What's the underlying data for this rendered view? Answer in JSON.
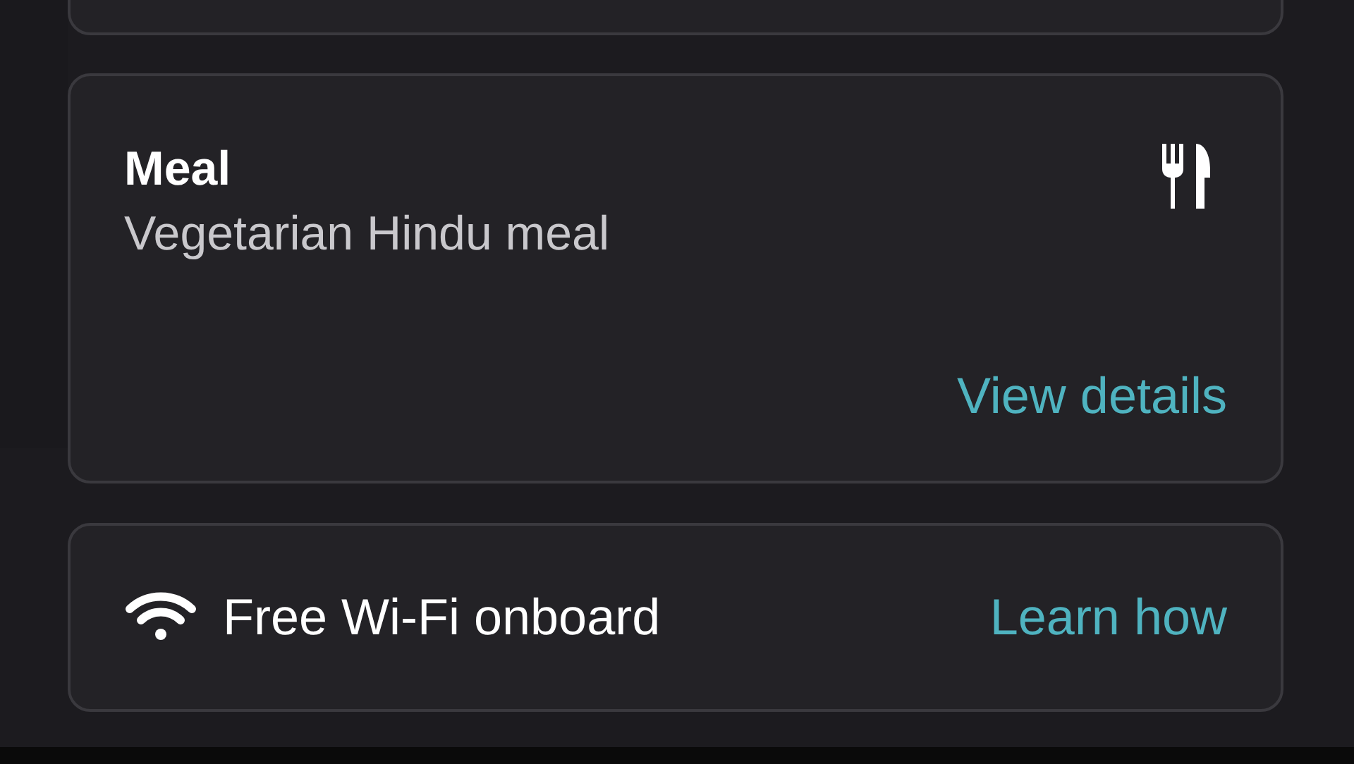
{
  "meal_card": {
    "title": "Meal",
    "subtitle": "Vegetarian Hindu meal",
    "link": "View details"
  },
  "wifi_card": {
    "label": "Free Wi-Fi onboard",
    "link": "Learn how"
  }
}
